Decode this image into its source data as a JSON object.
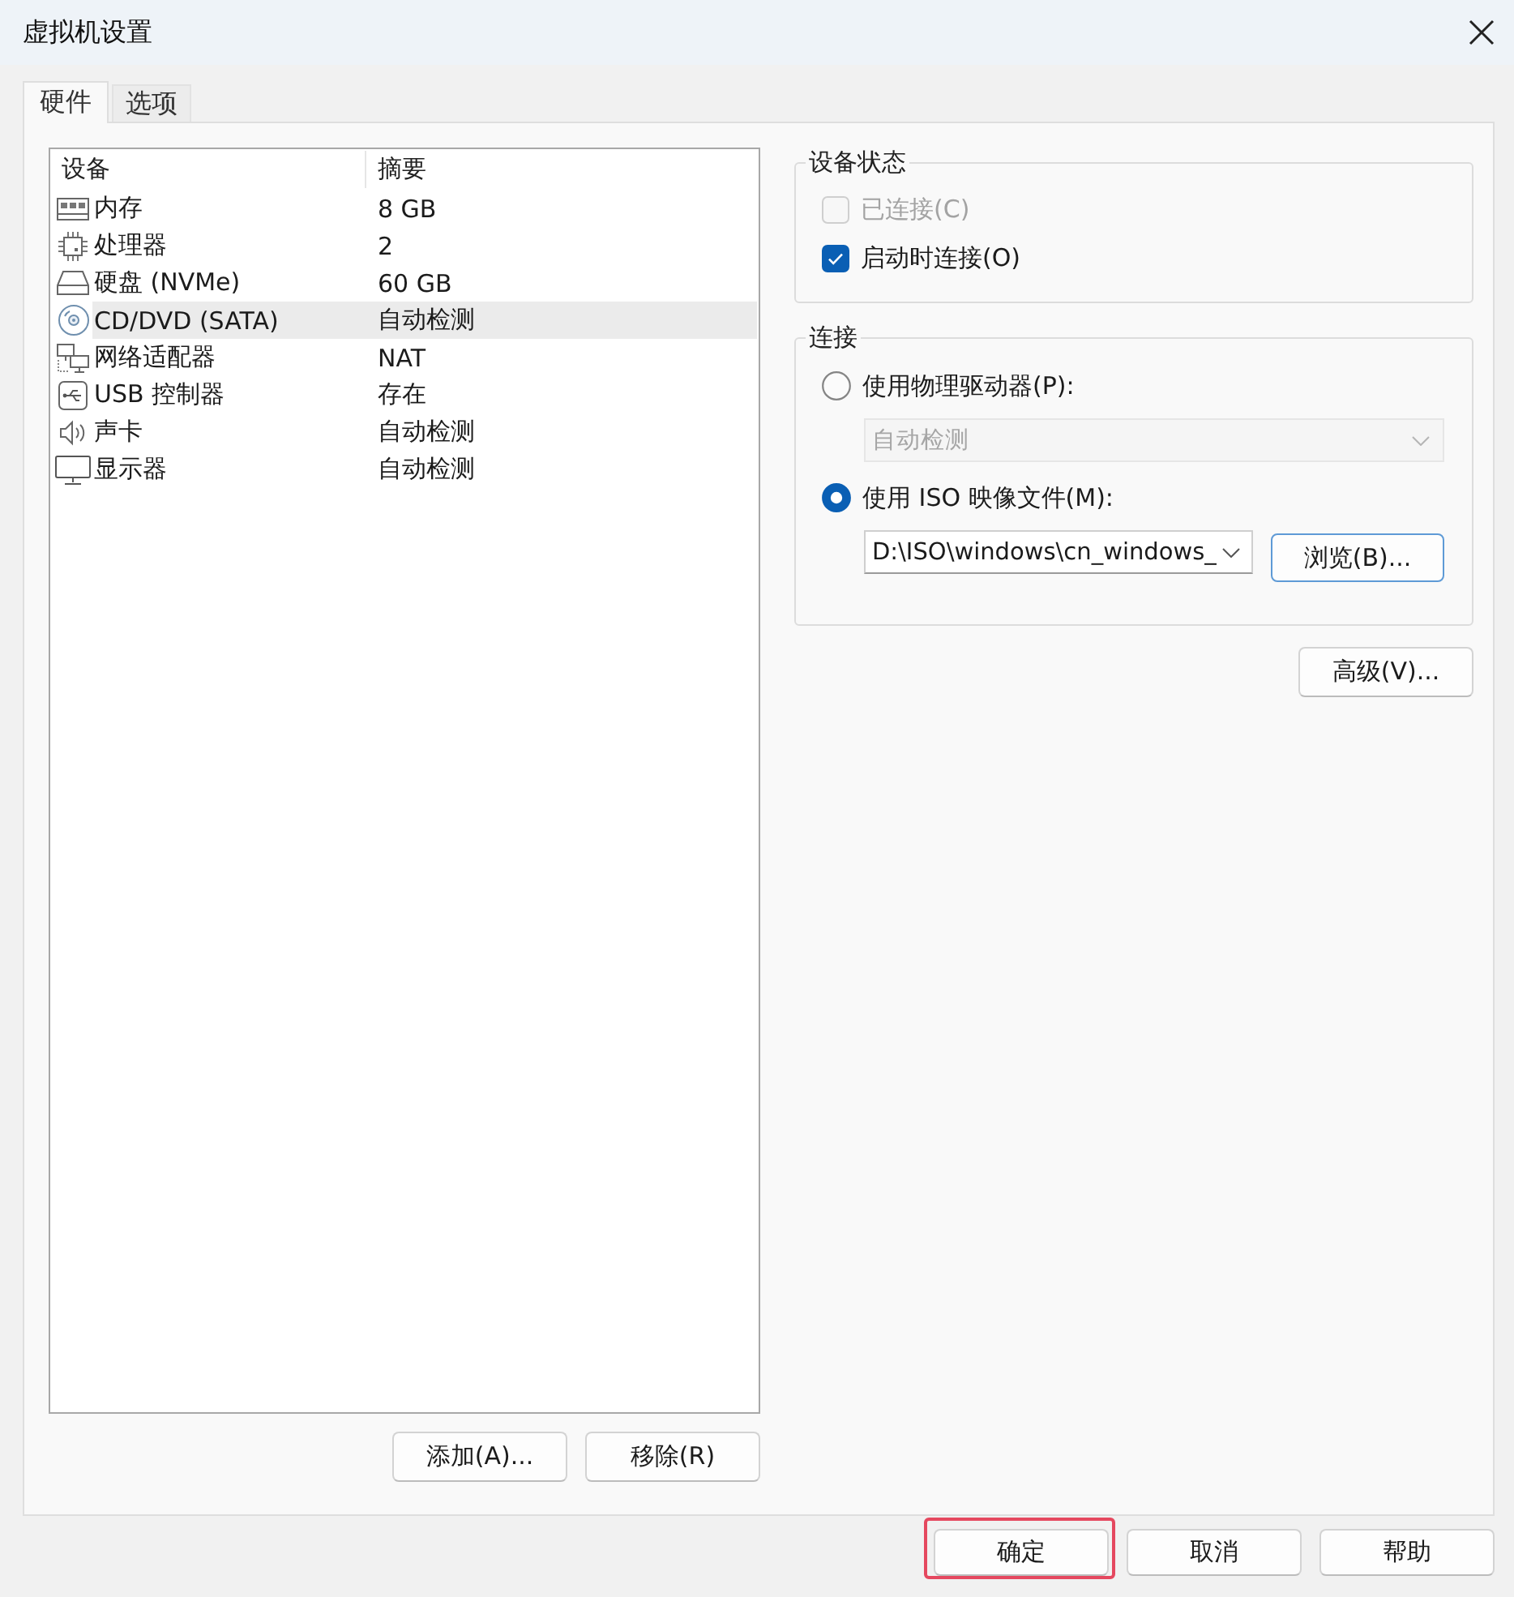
{
  "window": {
    "title": "虚拟机设置"
  },
  "tabs": [
    {
      "label": "硬件",
      "selected": true
    },
    {
      "label": "选项",
      "selected": false
    }
  ],
  "device_list": {
    "columns": [
      "设备",
      "摘要"
    ],
    "rows": [
      {
        "kind": "memory",
        "device": "内存",
        "summary": "8 GB",
        "selected": false
      },
      {
        "kind": "processor",
        "device": "处理器",
        "summary": "2",
        "selected": false
      },
      {
        "kind": "disk",
        "device": "硬盘 (NVMe)",
        "summary": "60 GB",
        "selected": false
      },
      {
        "kind": "cd",
        "device": "CD/DVD (SATA)",
        "summary": "自动检测",
        "selected": true
      },
      {
        "kind": "network",
        "device": "网络适配器",
        "summary": "NAT",
        "selected": false
      },
      {
        "kind": "usb",
        "device": "USB 控制器",
        "summary": "存在",
        "selected": false
      },
      {
        "kind": "sound",
        "device": "声卡",
        "summary": "自动检测",
        "selected": false
      },
      {
        "kind": "display",
        "device": "显示器",
        "summary": "自动检测",
        "selected": false
      }
    ]
  },
  "list_buttons": [
    {
      "label": "添加(A)..."
    },
    {
      "label": "移除(R)"
    }
  ],
  "device_status": {
    "title": "设备状态",
    "options": [
      {
        "label": "已连接(C)",
        "checked": false,
        "disabled": true
      },
      {
        "label": "启动时连接(O)",
        "checked": true,
        "disabled": false
      }
    ]
  },
  "connection": {
    "title": "连接",
    "options": [
      {
        "label": "使用物理驱动器(P):",
        "selected": false,
        "field": {
          "value": "自动检测",
          "disabled": true
        }
      },
      {
        "label": "使用 ISO 映像文件(M):",
        "selected": true,
        "field": {
          "value": "D:\\ISO\\windows\\cn_windows_",
          "disabled": false
        },
        "button": {
          "label": "浏览(B)...",
          "focused": true
        }
      }
    ]
  },
  "advanced_button": {
    "label": "高级(V)..."
  },
  "dialog_buttons": [
    {
      "label": "确定",
      "highlighted": true
    },
    {
      "label": "取消",
      "highlighted": false
    },
    {
      "label": "帮助",
      "highlighted": false
    }
  ]
}
